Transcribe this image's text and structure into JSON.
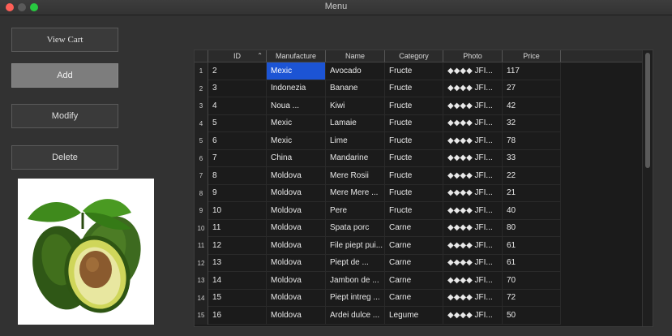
{
  "window": {
    "title": "Menu"
  },
  "buttons": {
    "view_cart": "View Cart",
    "add": "Add",
    "modify": "Modify",
    "delete": "Delete"
  },
  "table": {
    "columns": [
      "ID",
      "Manufacture",
      "Name",
      "Category",
      "Photo",
      "Price"
    ],
    "sort_column": "ID",
    "rows": [
      {
        "n": "1",
        "id": "2",
        "manufacture": "Mexic",
        "name": "Avocado",
        "category": "Fructe",
        "photo": "◆◆◆◆ JFI...",
        "price": "117"
      },
      {
        "n": "2",
        "id": "3",
        "manufacture": "Indonezia",
        "name": "Banane",
        "category": "Fructe",
        "photo": "◆◆◆◆ JFI...",
        "price": "27"
      },
      {
        "n": "3",
        "id": "4",
        "manufacture": "Noua ...",
        "name": "Kiwi",
        "category": "Fructe",
        "photo": "◆◆◆◆ JFI...",
        "price": "42"
      },
      {
        "n": "4",
        "id": "5",
        "manufacture": "Mexic",
        "name": "Lamaie",
        "category": "Fructe",
        "photo": "◆◆◆◆ JFI...",
        "price": "32"
      },
      {
        "n": "5",
        "id": "6",
        "manufacture": "Mexic",
        "name": "Lime",
        "category": "Fructe",
        "photo": "◆◆◆◆ JFI...",
        "price": "78"
      },
      {
        "n": "6",
        "id": "7",
        "manufacture": "China",
        "name": "Mandarine",
        "category": "Fructe",
        "photo": "◆◆◆◆ JFI...",
        "price": "33"
      },
      {
        "n": "7",
        "id": "8",
        "manufacture": "Moldova",
        "name": "Mere Rosii",
        "category": "Fructe",
        "photo": "◆◆◆◆ JFI...",
        "price": "22"
      },
      {
        "n": "8",
        "id": "9",
        "manufacture": "Moldova",
        "name": "Mere Mere ...",
        "category": "Fructe",
        "photo": "◆◆◆◆ JFI...",
        "price": "21"
      },
      {
        "n": "9",
        "id": "10",
        "manufacture": "Moldova",
        "name": "Pere",
        "category": "Fructe",
        "photo": "◆◆◆◆ JFI...",
        "price": "40"
      },
      {
        "n": "10",
        "id": "11",
        "manufacture": "Moldova",
        "name": "Spata porc",
        "category": "Carne",
        "photo": "◆◆◆◆ JFI...",
        "price": "80"
      },
      {
        "n": "11",
        "id": "12",
        "manufacture": "Moldova",
        "name": "File piept pui...",
        "category": "Carne",
        "photo": "◆◆◆◆ JFI...",
        "price": "61"
      },
      {
        "n": "12",
        "id": "13",
        "manufacture": "Moldova",
        "name": "Piept de ...",
        "category": "Carne",
        "photo": "◆◆◆◆ JFI...",
        "price": "61"
      },
      {
        "n": "13",
        "id": "14",
        "manufacture": "Moldova",
        "name": "Jambon de ...",
        "category": "Carne",
        "photo": "◆◆◆◆ JFI...",
        "price": "70"
      },
      {
        "n": "14",
        "id": "15",
        "manufacture": "Moldova",
        "name": "Piept intreg ...",
        "category": "Carne",
        "photo": "◆◆◆◆ JFI...",
        "price": "72"
      },
      {
        "n": "15",
        "id": "16",
        "manufacture": "Moldova",
        "name": "Ardei dulce ...",
        "category": "Legume",
        "photo": "◆◆◆◆ JFI...",
        "price": "50"
      }
    ]
  },
  "colors": {
    "selection": "#1c54d4",
    "active_button": "#7d7d7d"
  }
}
